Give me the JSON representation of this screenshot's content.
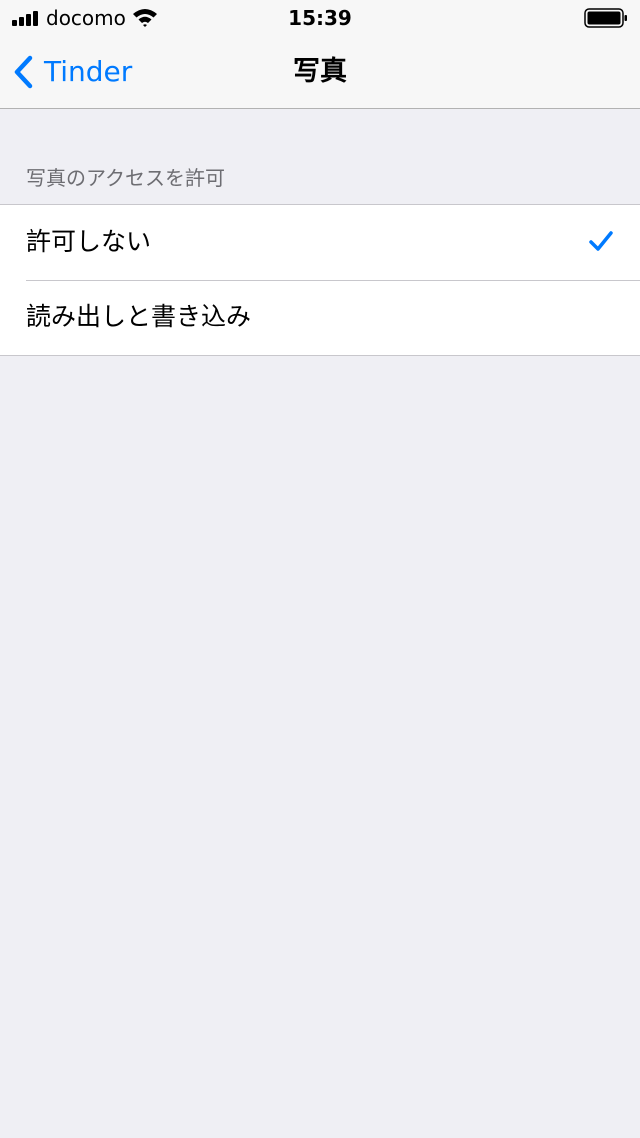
{
  "status_bar": {
    "carrier": "docomo",
    "time": "15:39"
  },
  "nav": {
    "back_label": "Tinder",
    "title": "写真"
  },
  "section": {
    "header": "写真のアクセスを許可",
    "options": [
      {
        "label": "許可しない",
        "selected": true
      },
      {
        "label": "読み出しと書き込み",
        "selected": false
      }
    ]
  },
  "colors": {
    "accent": "#007aff",
    "background": "#efeff4"
  }
}
